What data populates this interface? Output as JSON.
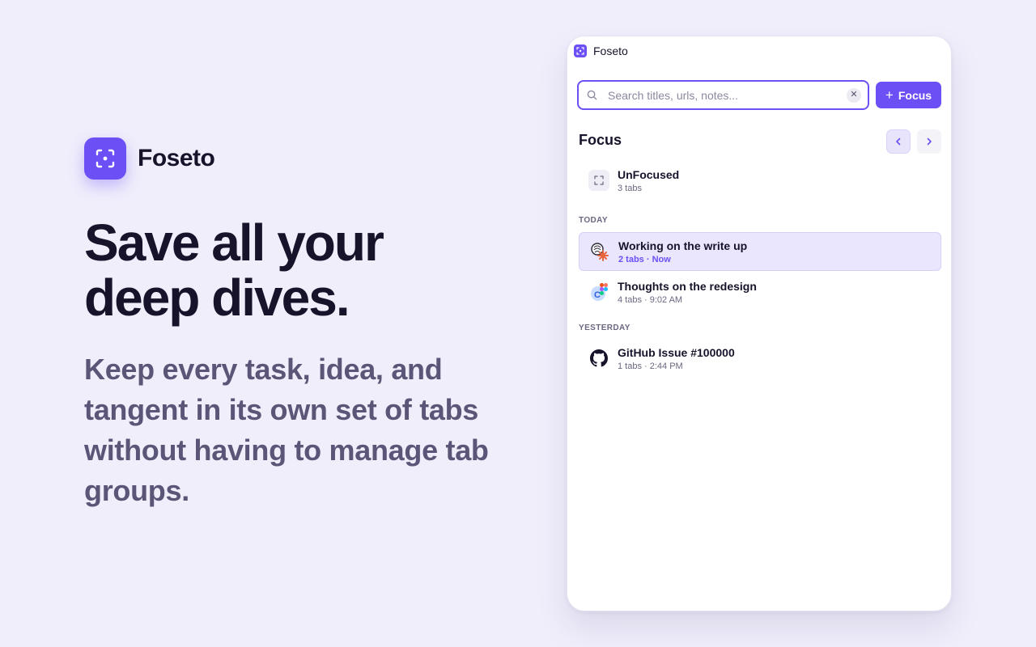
{
  "brand": {
    "name": "Foseto",
    "headline": "Save all your deep dives.",
    "subhead": "Keep every task, idea, and tangent in its own set of tabs without having to manage tab groups.",
    "accent_color": "#6d4ff6"
  },
  "popup": {
    "title": "Foseto",
    "search": {
      "placeholder": "Search titles, urls, notes...",
      "value": "",
      "clear_icon": "close-icon"
    },
    "focus_button": {
      "label": "Focus",
      "icon": "plus-icon"
    },
    "section_title": "Focus",
    "unfocused": {
      "title": "UnFocused",
      "meta": "3 tabs",
      "icon": "focus-frame-icon"
    },
    "groups": [
      {
        "label": "TODAY",
        "items": [
          {
            "title": "Working on the write up",
            "meta": "2 tabs · Now",
            "icon": "writing-favicon-icon",
            "active": true
          },
          {
            "title": "Thoughts on the redesign",
            "meta": "4 tabs · 9:02 AM",
            "icon": "design-favicon-icon",
            "active": false
          }
        ]
      },
      {
        "label": "YESTERDAY",
        "items": [
          {
            "title": "GitHub Issue #100000",
            "meta": "1 tabs · 2:44 PM",
            "icon": "github-icon",
            "active": false
          }
        ]
      }
    ]
  }
}
